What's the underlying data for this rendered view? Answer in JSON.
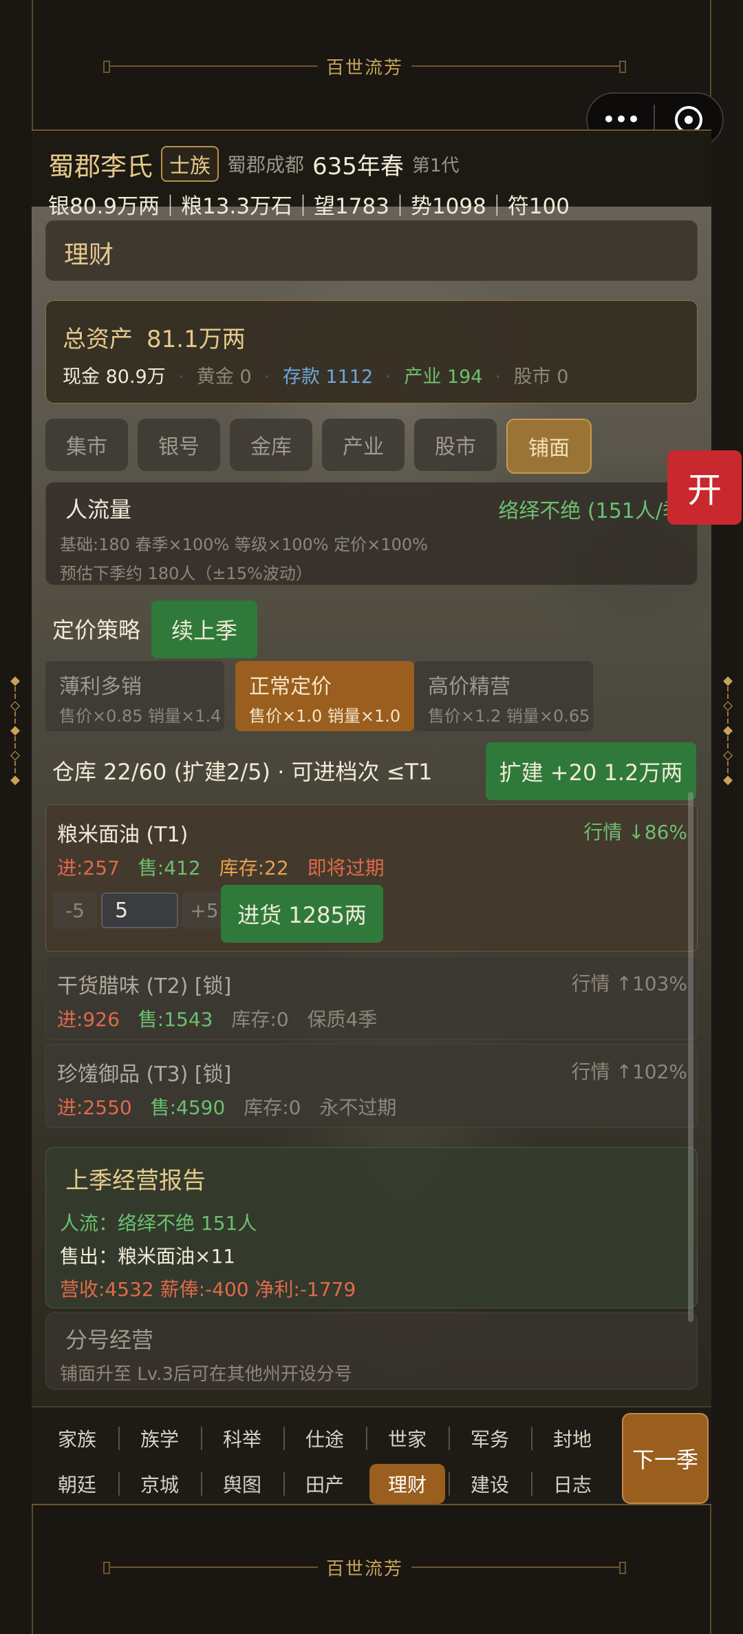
{
  "game_title": "百世流芳",
  "clan": {
    "name": "蜀郡李氏",
    "rank": "士族",
    "location": "蜀郡成都",
    "year": "635年春",
    "generation": "第1代"
  },
  "resources": "银80.9万两｜粮13.3万石｜望1783｜势1098｜符100",
  "section_title": "理财",
  "assets": {
    "total_label": "总资产",
    "total_value": "81.1万两",
    "cash": "现金 80.9万",
    "gold": "黄金 0",
    "deposit": "存款 1112",
    "industry": "产业 194",
    "stock": "股市 0"
  },
  "tabs": [
    "集市",
    "银号",
    "金库",
    "产业",
    "股市",
    "铺面"
  ],
  "active_tab": "铺面",
  "traffic": {
    "title": "人流量",
    "status": "络绎不绝 (151人/季",
    "detail": "基础:180  春季×100%  等级×100%  定价×100%",
    "forecast": "预估下季约 180人（±15%波动）"
  },
  "pricing": {
    "label": "定价策略",
    "continue_label": "续上季",
    "options": [
      {
        "name": "薄利多销",
        "desc": "售价×0.85 销量×1.4"
      },
      {
        "name": "正常定价",
        "desc": "售价×1.0 销量×1.0"
      },
      {
        "name": "高价精营",
        "desc": "售价×1.2 销量×0.65"
      }
    ]
  },
  "warehouse": {
    "text": "仓库 22/60 (扩建2/5) · 可进档次 ≤T1",
    "expand_label": "扩建 +20 1.2万两"
  },
  "goods": [
    {
      "name": "粮米面油 (T1)",
      "market": "行情 ↓86%",
      "buy": "进:257",
      "sell": "售:412",
      "stock": "库存:22",
      "note": "即将过期",
      "qty": "5",
      "minus": "-5",
      "plus": "+5",
      "buy_btn": "进货 1285两"
    },
    {
      "name": "干货腊味 (T2) [锁]",
      "market": "行情 ↑103%",
      "buy": "进:926",
      "sell": "售:1543",
      "stock": "库存:0",
      "note": "保质4季"
    },
    {
      "name": "珍馐御品 (T3) [锁]",
      "market": "行情 ↑102%",
      "buy": "进:2550",
      "sell": "售:4590",
      "stock": "库存:0",
      "note": "永不过期"
    }
  ],
  "report": {
    "title": "上季经营报告",
    "traffic": "人流：络绎不绝 151人",
    "sold": "售出：粮米面油×11",
    "finance": "营收:4532 薪俸:-400 净利:-1779"
  },
  "branch": {
    "title": "分号经营",
    "desc": "铺面升至 Lv.3后可在其他州开设分号"
  },
  "open_label": "开",
  "nav_row1": [
    "家族",
    "族学",
    "科举",
    "仕途",
    "世家",
    "军务",
    "封地"
  ],
  "nav_row2": [
    "朝廷",
    "京城",
    "舆图",
    "田产",
    "理财",
    "建设",
    "日志"
  ],
  "next_label": "下一季",
  "colors": {
    "gold": "#e6c98a",
    "green": "#2f7a3a",
    "active": "#9a5e1e",
    "red": "#c8282e"
  }
}
